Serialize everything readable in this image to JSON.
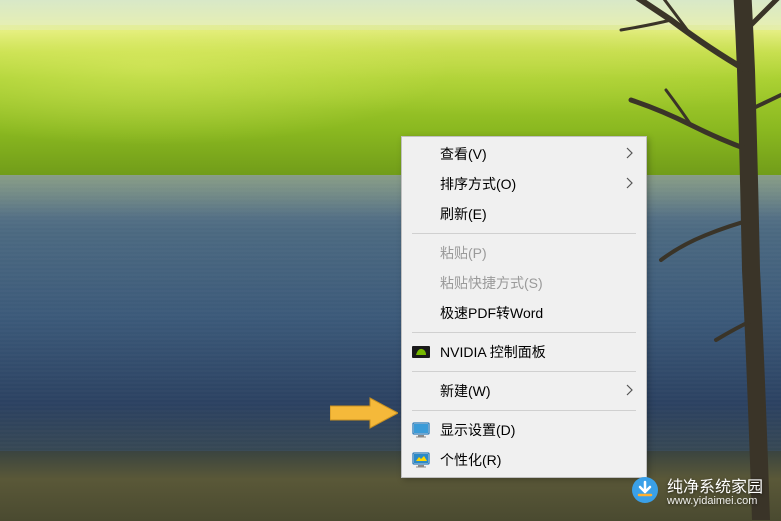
{
  "menu": {
    "view": "查看(V)",
    "sort": "排序方式(O)",
    "refresh": "刷新(E)",
    "paste": "粘贴(P)",
    "paste_shortcut": "粘贴快捷方式(S)",
    "pdf_to_word": "极速PDF转Word",
    "nvidia": "NVIDIA 控制面板",
    "new": "新建(W)",
    "display_settings": "显示设置(D)",
    "personalize": "个性化(R)"
  },
  "watermark": {
    "title": "纯净系统家园",
    "url": "www.yidaimei.com"
  }
}
